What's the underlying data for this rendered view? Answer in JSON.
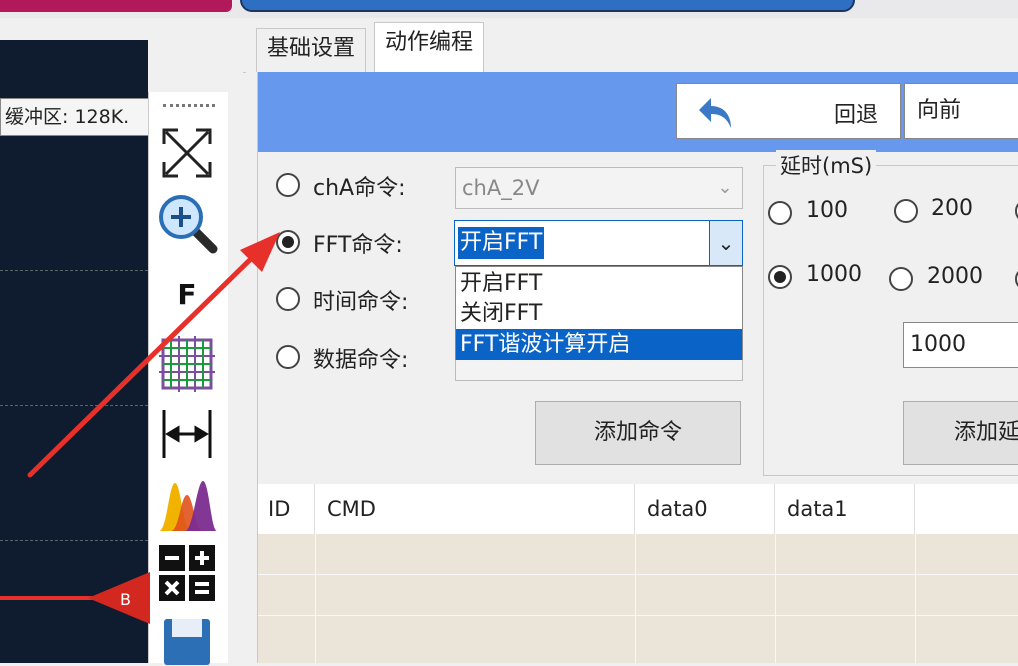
{
  "scope": {
    "buffer_label": "缓冲区: 128K.",
    "marker_label": "B"
  },
  "toolbar": {
    "icons": [
      "fullscreen-icon",
      "zoom-in-icon",
      "font-icon",
      "grid-icon",
      "width-measure-icon",
      "spectrum-icon",
      "math-icon",
      "save-icon"
    ],
    "font_glyph": "F"
  },
  "tabs": [
    {
      "label": "基础设置",
      "active": false
    },
    {
      "label": "动作编程",
      "active": true
    }
  ],
  "header": {
    "back_label": "回退",
    "forward_label": "向前"
  },
  "commands": {
    "rows": [
      {
        "label": "chA命令:",
        "selected": false,
        "value": "chA_2V"
      },
      {
        "label": "FFT命令:",
        "selected": true,
        "value": "开启FFT"
      },
      {
        "label": "时间命令:",
        "selected": false,
        "value": ""
      },
      {
        "label": "数据命令:",
        "selected": false,
        "value": ""
      }
    ],
    "dropdown_options": [
      "开启FFT",
      "关闭FFT",
      "FFT谐波计算开启"
    ],
    "dropdown_highlight_index": 2,
    "add_label": "添加命令"
  },
  "delay": {
    "legend": "延时(mS)",
    "options": [
      "100",
      "200",
      "1000",
      "2000"
    ],
    "selected": "1000",
    "input_value": "1000",
    "add_label": "添加延"
  },
  "table": {
    "columns": [
      "ID",
      "CMD",
      "data0",
      "data1"
    ]
  },
  "colors": {
    "scope_bg": "#0f1b2e",
    "header_blue": "#6699ee",
    "selection_blue": "#0a64c8",
    "annotation_red": "#e8302a",
    "table_row": "#ebe4d8"
  }
}
